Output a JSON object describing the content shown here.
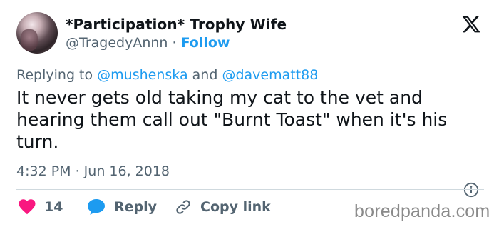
{
  "author": {
    "display_name": "*Participation* Trophy Wife",
    "handle": "@TragedyAnnn",
    "separator": "·",
    "follow_label": "Follow"
  },
  "reply_context": {
    "prefix": "Replying to",
    "mention_1": "@mushenska",
    "conjunction": "and",
    "mention_2": "@davematt88"
  },
  "tweet": {
    "text": "It never gets old taking my cat to the vet and hearing them call out \"Burnt Toast\" when it's his turn.",
    "timestamp": "4:32 PM · Jun 16, 2018"
  },
  "actions": {
    "like_count": "14",
    "reply_label": "Reply",
    "copy_link_label": "Copy link"
  },
  "watermark": "boredpanda.com",
  "colors": {
    "accent": "#1d9bf0",
    "like": "#f91880",
    "secondary_text": "#536471",
    "primary_text": "#0f1419"
  },
  "icons": [
    "x-logo-icon",
    "info-icon",
    "heart-icon",
    "reply-bubble-icon",
    "link-icon"
  ]
}
